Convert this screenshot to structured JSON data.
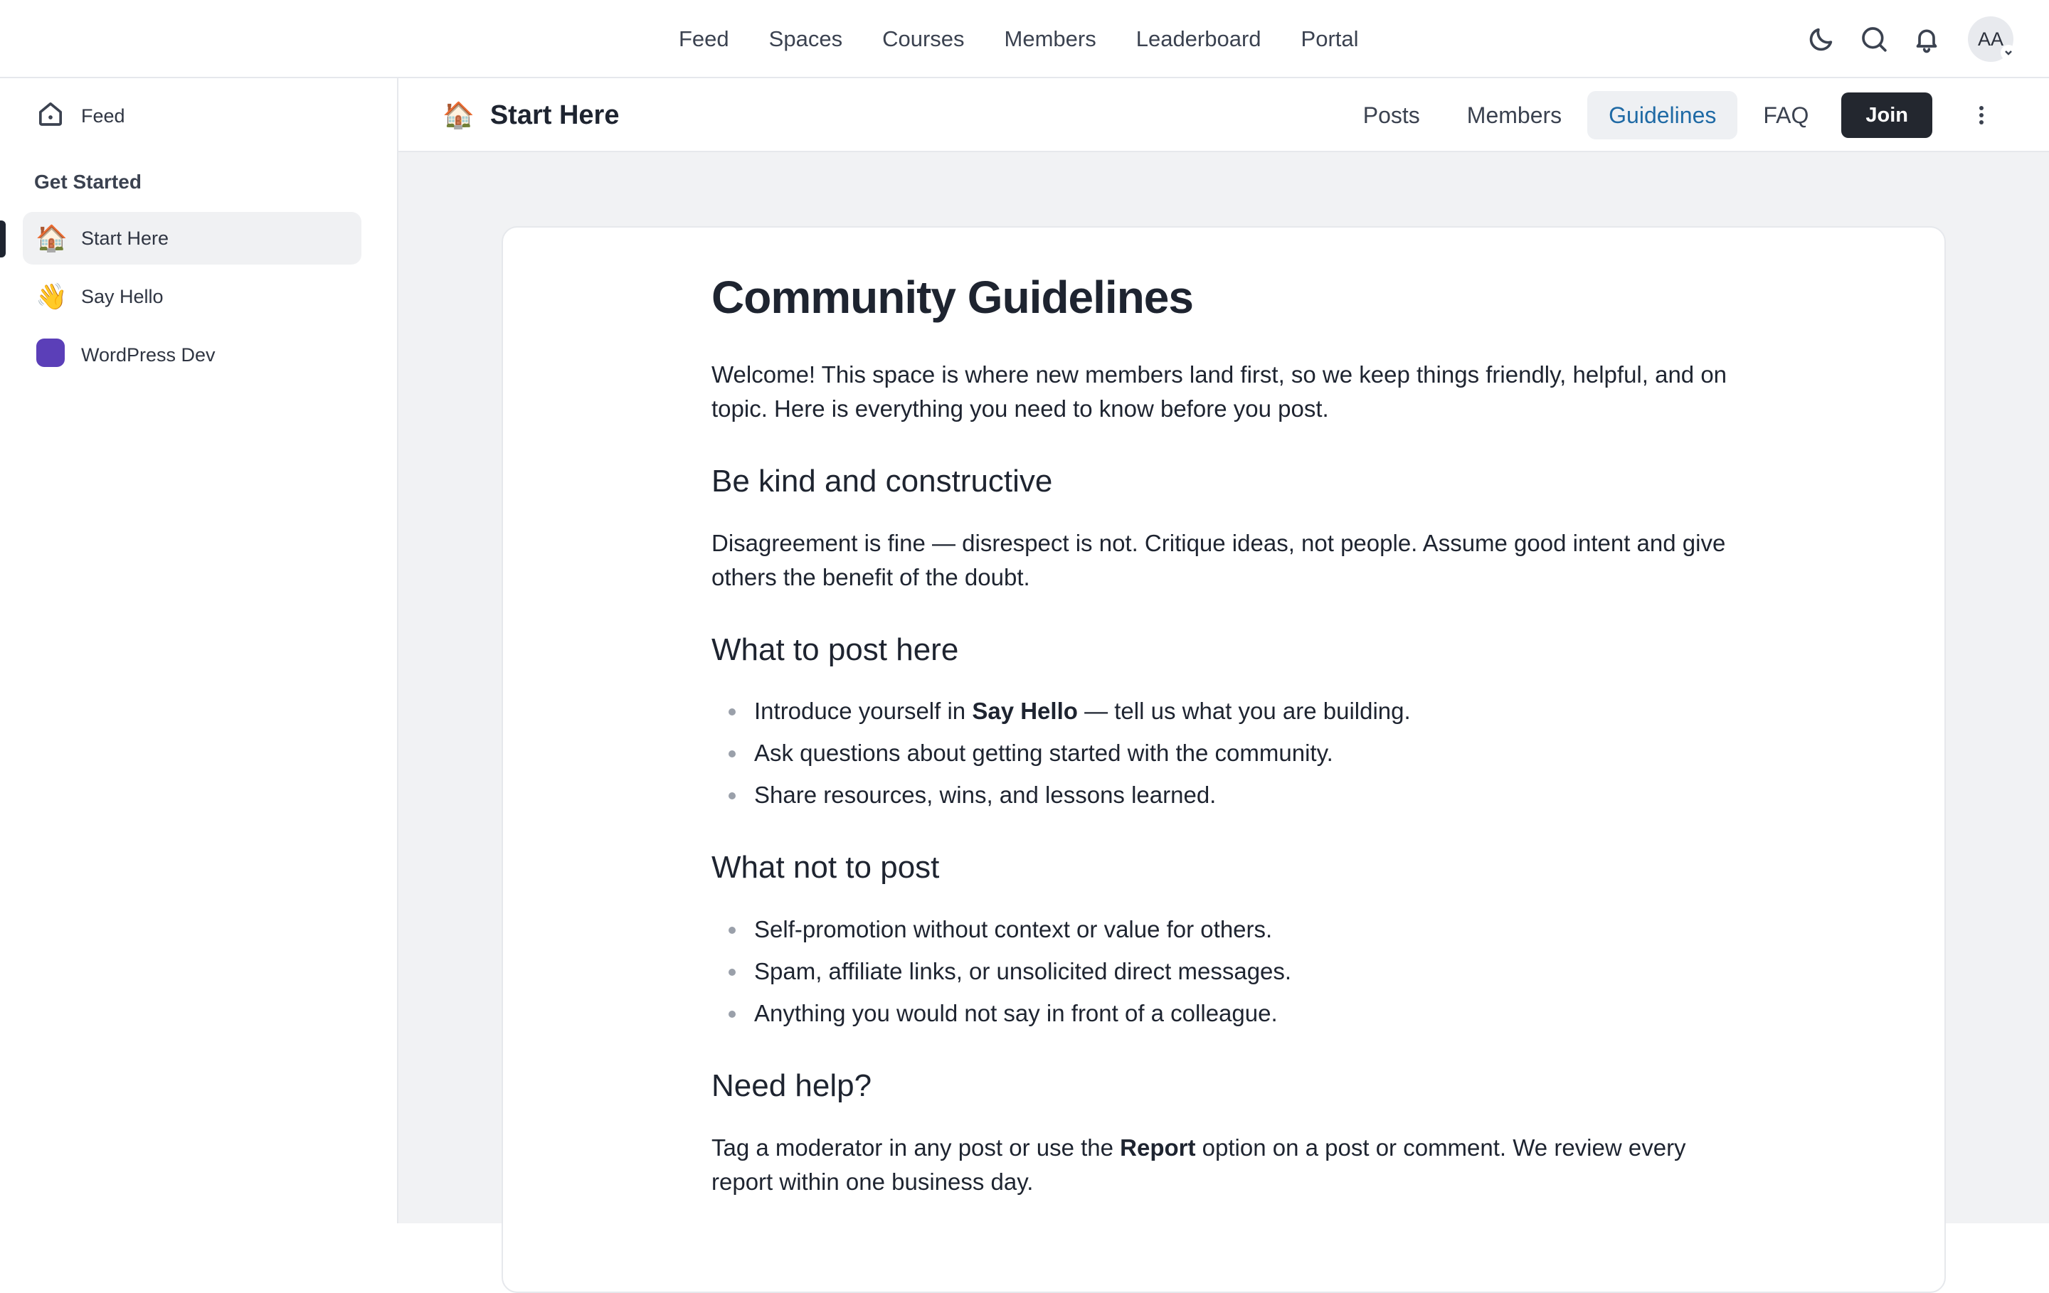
{
  "topnav": {
    "items": [
      "Feed",
      "Spaces",
      "Courses",
      "Members",
      "Leaderboard",
      "Portal"
    ]
  },
  "user": {
    "initials": "AA"
  },
  "sidebar": {
    "feed_label": "Feed",
    "section_title": "Get Started",
    "items": [
      {
        "emoji": "🏠",
        "label": "Start Here",
        "active": true
      },
      {
        "emoji": "👋",
        "label": "Say Hello",
        "active": false
      },
      {
        "label": "WordPress Dev",
        "active": false,
        "color": "#5b3fb8"
      }
    ]
  },
  "space": {
    "emoji": "🏠",
    "title": "Start Here",
    "tabs": [
      "Posts",
      "Members",
      "Guidelines",
      "FAQ"
    ],
    "active_tab": "Guidelines",
    "join_label": "Join"
  },
  "doc": {
    "title": "Community Guidelines",
    "intro": "Welcome! This space is where new members land first, so we keep things friendly, helpful, and on topic. Here is everything you need to know before you post.",
    "s1_heading": "Be kind and constructive",
    "s1_text": "Disagreement is fine — disrespect is not. Critique ideas, not people. Assume good intent and give others the benefit of the doubt.",
    "s2_heading": "What to post here",
    "s2_item1_pre": "Introduce yourself in ",
    "s2_item1_bold": "Say Hello",
    "s2_item1_post": " — tell us what you are building.",
    "s2_item2": "Ask questions about getting started with the community.",
    "s2_item3": "Share resources, wins, and lessons learned.",
    "s3_heading": "What not to post",
    "s3_item1": "Self-promotion without context or value for others.",
    "s3_item2": "Spam, affiliate links, or unsolicited direct messages.",
    "s3_item3": "Anything you would not say in front of a colleague.",
    "s4_heading": "Need help?",
    "s4_pre": "Tag a moderator in any post or use the ",
    "s4_bold": "Report",
    "s4_post": " option on a post or comment. We review every report within one business day."
  },
  "colors": {
    "accent": "#1f6aa5",
    "join_bg": "#23272f",
    "page_bg": "#f1f2f4"
  }
}
